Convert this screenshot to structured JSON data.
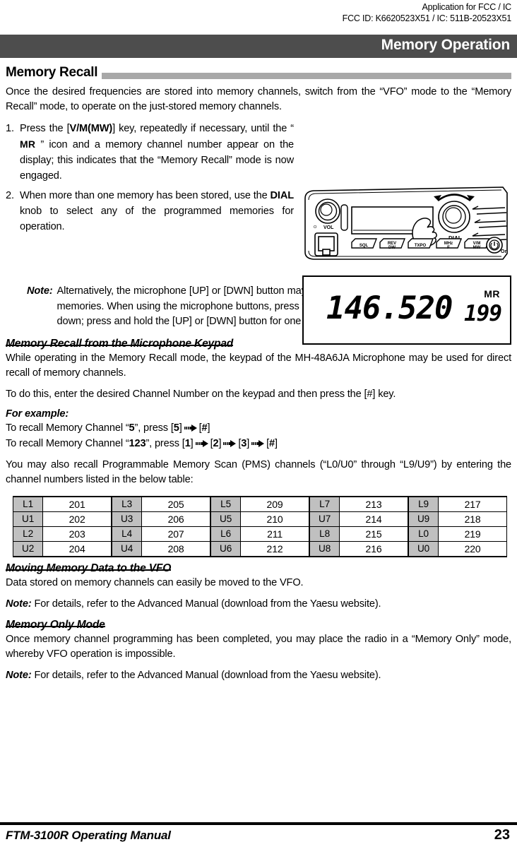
{
  "app_header": {
    "line1": "Application for FCC / IC",
    "line2": "FCC ID: K6620523X51 / IC: 511B-20523X51"
  },
  "chapter": {
    "title": "Memory Operation",
    "band_color": "#4d4d4d"
  },
  "section_memory_recall": {
    "heading": "Memory Recall",
    "rule_color": "#a8a8a8",
    "intro": "Once the desired frequencies are stored into memory channels, switch from the “VFO” mode to the “Memory Recall” mode, to operate on the just-stored memory channels.",
    "steps": [
      {
        "num": "1.",
        "part1": "Press the [",
        "key": "V/M(MW)",
        "part2": "] key, repeatedly if necessary, until the “ ",
        "icon_label": "MR",
        "part3": " ” icon and a memory channel number appear on the display; this indicates that the “Memory Recall” mode is now engaged."
      },
      {
        "num": "2.",
        "part1": "When more than one memory has been stored, use the ",
        "key": "DIAL",
        "part2": " knob to select any of the programmed memories for operation."
      }
    ],
    "note": {
      "label": "Note:",
      "text": "Alternatively, the microphone [UP] or [DWN] button may be used to step or scan through the available memories. When using the microphone buttons, press the button momentarily to move one step up or down; press and hold the [UP] or [DWN] button for one second to begin memory scanning."
    }
  },
  "radio_artwork": {
    "knob_left_label": "VOL",
    "knob_right_label": "DIAL",
    "power_label": "On",
    "buttons": [
      "SQL",
      "REV/DW",
      "TXPO",
      "MHz/F",
      "V/M(MW)"
    ]
  },
  "lcd_display": {
    "frequency": "146.520",
    "mode_icon": "MR",
    "channel": "199"
  },
  "section_keypad": {
    "heading": "Memory Recall from the Microphone Keypad",
    "para1": "While operating in the Memory Recall mode, the keypad of the MH-48A6JA Microphone may be used for direct recall of memory channels.",
    "para2": "To do this, enter the desired Channel Number on the keypad and then press the [#] key.",
    "for_example_label": "For example:",
    "example1": {
      "pre": "To recall Memory Channel “",
      "channel": "5",
      "mid": "”, press [",
      "keys": [
        "5",
        "#"
      ]
    },
    "example2": {
      "pre": "To recall Memory Channel “",
      "channel": "123",
      "mid": "”, press [",
      "keys": [
        "1",
        "2",
        "3",
        "#"
      ]
    },
    "pms_intro": "You may also recall Programmable Memory Scan (PMS) channels (“L0/U0” through “L9/U9”) by entering the channel numbers listed in the below table:"
  },
  "pms_table": {
    "rows": [
      [
        {
          "label": "L1",
          "value": "201"
        },
        {
          "label": "L3",
          "value": "205"
        },
        {
          "label": "L5",
          "value": "209"
        },
        {
          "label": "L7",
          "value": "213"
        },
        {
          "label": "L9",
          "value": "217"
        }
      ],
      [
        {
          "label": "U1",
          "value": "202"
        },
        {
          "label": "U3",
          "value": "206"
        },
        {
          "label": "U5",
          "value": "210"
        },
        {
          "label": "U7",
          "value": "214"
        },
        {
          "label": "U9",
          "value": "218"
        }
      ],
      [
        {
          "label": "L2",
          "value": "203"
        },
        {
          "label": "L4",
          "value": "207"
        },
        {
          "label": "L6",
          "value": "211"
        },
        {
          "label": "L8",
          "value": "215"
        },
        {
          "label": "L0",
          "value": "219"
        }
      ],
      [
        {
          "label": "U2",
          "value": "204"
        },
        {
          "label": "U4",
          "value": "208"
        },
        {
          "label": "U6",
          "value": "212"
        },
        {
          "label": "U8",
          "value": "216"
        },
        {
          "label": "U0",
          "value": "220"
        }
      ]
    ],
    "label_cell_color": "#c0c0c0"
  },
  "section_moving": {
    "heading": "Moving Memory Data to the VFO",
    "para": "Data stored on memory channels can easily be moved to the VFO.",
    "note_label": "Note:",
    "note_text": "For details, refer to the Advanced Manual (download from the Yaesu website)."
  },
  "section_memory_only": {
    "heading": "Memory Only Mode",
    "para": "Once memory channel programming has been completed, you may place the radio in a “Memory Only” mode, whereby VFO operation is impossible.",
    "note_label": "Note:",
    "note_text": "For details, refer to the Advanced Manual (download from the Yaesu website)."
  },
  "footer": {
    "manual": "FTM-3100R Operating Manual",
    "page": "23"
  }
}
